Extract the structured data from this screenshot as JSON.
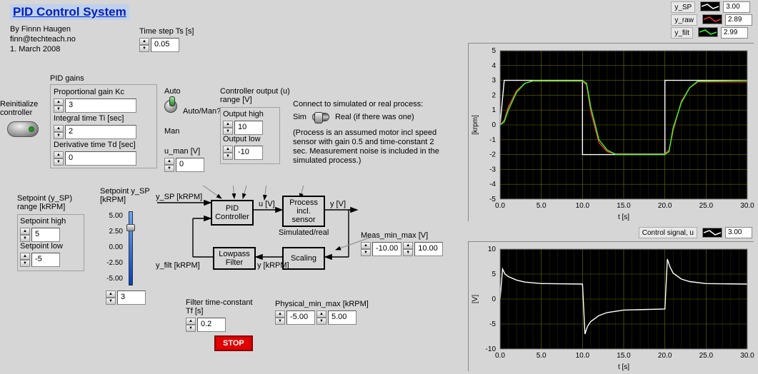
{
  "title": "PID Control System",
  "author": "By Finnn Haugen",
  "email": "finn@techteach.no",
  "date": "1. March 2008",
  "time_step": {
    "label": "Time step Ts [s]",
    "value": "0.05"
  },
  "reinit_label": "Reinitialize\ncontroller",
  "pid_gains": {
    "section": "PID gains",
    "kc": {
      "label": "Proportional gain Kc",
      "value": "3"
    },
    "ti": {
      "label": "Integral time Ti [sec]",
      "value": "2"
    },
    "td": {
      "label": "Derivative time Td [sec]",
      "value": "0"
    }
  },
  "auto_man": {
    "auto": "Auto",
    "man": "Man",
    "label": "Auto/Man?"
  },
  "u_man": {
    "label": "u_man [V]",
    "value": "0"
  },
  "ctrl_out": {
    "label": "Controller output (u)\nrange [V]",
    "high": {
      "label": "Output high",
      "value": "10"
    },
    "low": {
      "label": "Output low",
      "value": "-10"
    }
  },
  "connect": {
    "label": "Connect to simulated or real process:",
    "sim": "Sim",
    "real": "Real (if there was one)",
    "note": "(Process is an assumed motor incl speed sensor with gain 0.5 and time-constant 2 sec. Measurement noise is included in the simulated process.)"
  },
  "setpoint_range": {
    "label": "Setpoint (y_SP)\nrange [kRPM]",
    "high": {
      "label": "Setpoint high",
      "value": "5"
    },
    "low": {
      "label": "Setpoint low",
      "value": "-5"
    }
  },
  "slider": {
    "label": "Setpoint y_SP\n[kRPM]",
    "ticks": [
      "5.00",
      "2.50",
      "0.00",
      "-2.50",
      "-5.00"
    ],
    "value": "3"
  },
  "diagram": {
    "ysp": "y_SP [kRPM]",
    "u": "u [V]",
    "y": "y [V]",
    "yfilt": "y_filt [kRPM]",
    "ykrpm": "y [kRPM]",
    "pid": "PID\nController",
    "process": "Process\nincl.\nsensor",
    "simreal": "Simulated/real",
    "lowpass": "Lowpass\nFilter",
    "scaling": "Scaling"
  },
  "meas": {
    "label": "Meas_min_max [V]",
    "min": "-10.00",
    "max": "10.00"
  },
  "phys": {
    "label": "Physical_min_max [kRPM]",
    "min": "-5.00",
    "max": "5.00"
  },
  "filter_tc": {
    "label": "Filter time-constant\nTf [s]",
    "value": "0.2"
  },
  "stop": "STOP",
  "legend_top": {
    "items": [
      {
        "name": "y_SP",
        "color": "#ffffff",
        "value": "3.00"
      },
      {
        "name": "y_raw",
        "color": "#ff3030",
        "value": "2.89"
      },
      {
        "name": "y_filt",
        "color": "#30ff30",
        "value": "2.99"
      }
    ]
  },
  "legend_bottom": {
    "name": "Control signal, u",
    "color": "#ffffff",
    "value": "3.00"
  },
  "chart_data": [
    {
      "type": "line",
      "title": "",
      "xlabel": "t [s]",
      "ylabel": "[krpm]",
      "xlim": [
        0,
        30
      ],
      "ylim": [
        -5,
        5
      ],
      "xticks": [
        0,
        5,
        10,
        15,
        20,
        25,
        30
      ],
      "yticks": [
        -5,
        -4,
        -3,
        -2,
        -1,
        0,
        1,
        2,
        3,
        4,
        5
      ],
      "series": [
        {
          "name": "y_SP",
          "color": "#ffffff",
          "x": [
            0,
            0.5,
            10,
            10,
            20,
            20,
            30
          ],
          "values": [
            0,
            3,
            3,
            -2,
            -2,
            3,
            3
          ]
        },
        {
          "name": "y_raw",
          "color": "#ff3030",
          "x": [
            0,
            0.5,
            1,
            2,
            3,
            4,
            10,
            10.5,
            11,
            12,
            13,
            14,
            20,
            20.5,
            21,
            22,
            23,
            24,
            30
          ],
          "values": [
            0,
            0.3,
            1.2,
            2.3,
            2.8,
            2.95,
            2.95,
            2.7,
            0.9,
            -1.2,
            -1.8,
            -1.95,
            -1.95,
            -1.7,
            -0.4,
            1.6,
            2.5,
            2.9,
            2.9
          ]
        },
        {
          "name": "y_filt",
          "color": "#30ff30",
          "x": [
            0,
            0.5,
            1,
            2,
            3,
            4,
            10,
            10.5,
            11,
            12,
            13,
            14,
            20,
            20.5,
            21,
            22,
            23,
            24,
            30
          ],
          "values": [
            0,
            0.2,
            1.0,
            2.2,
            2.8,
            2.98,
            2.98,
            2.8,
            1.2,
            -1.0,
            -1.7,
            -1.98,
            -1.98,
            -1.8,
            -0.2,
            1.5,
            2.5,
            2.95,
            2.99
          ]
        }
      ]
    },
    {
      "type": "line",
      "title": "",
      "xlabel": "t [s]",
      "ylabel": "[V]",
      "xlim": [
        0,
        30
      ],
      "ylim": [
        -10,
        10
      ],
      "xticks": [
        0,
        5,
        10,
        15,
        20,
        25,
        30
      ],
      "yticks": [
        -10,
        -5,
        0,
        5,
        10
      ],
      "series": [
        {
          "name": "u",
          "color": "#ffffff",
          "x": [
            0,
            0.3,
            0.6,
            1,
            2,
            3,
            5,
            10,
            10.3,
            10.6,
            11,
            12,
            13,
            15,
            20,
            20.3,
            20.6,
            21,
            22,
            23,
            25,
            30
          ],
          "values": [
            0,
            6,
            5,
            4.5,
            3.8,
            3.4,
            3.1,
            3.0,
            -7,
            -5.5,
            -4.5,
            -3.3,
            -2.7,
            -2.2,
            -2.0,
            8,
            6.5,
            5.2,
            4.0,
            3.5,
            3.1,
            3.0
          ]
        }
      ]
    }
  ]
}
